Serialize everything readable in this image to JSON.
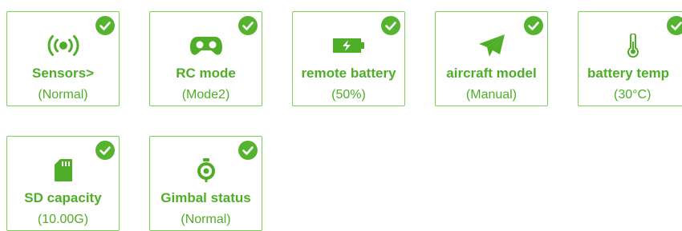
{
  "colors": {
    "accent": "#4fae27",
    "border": "#7ccf5a",
    "check_bg": "#56b330"
  },
  "tiles": [
    {
      "title": "Sensors>",
      "status": "(Normal)",
      "icon": "sensor-signal-icon",
      "checked": true
    },
    {
      "title": "RC mode",
      "status": "(Mode2)",
      "icon": "gamepad-icon",
      "checked": true
    },
    {
      "title": "remote battery",
      "status": "(50%)",
      "icon": "battery-charging-icon",
      "checked": true
    },
    {
      "title": "aircraft model",
      "status": "(Manual)",
      "icon": "paper-plane-icon",
      "checked": true
    },
    {
      "title": "battery temp",
      "status": "(30°C)",
      "icon": "thermometer-icon",
      "checked": true
    },
    {
      "title": "SD capacity",
      "status": "(10.00G)",
      "icon": "sd-card-icon",
      "checked": true
    },
    {
      "title": "Gimbal status",
      "status": "(Normal)",
      "icon": "gimbal-icon",
      "checked": true
    }
  ]
}
